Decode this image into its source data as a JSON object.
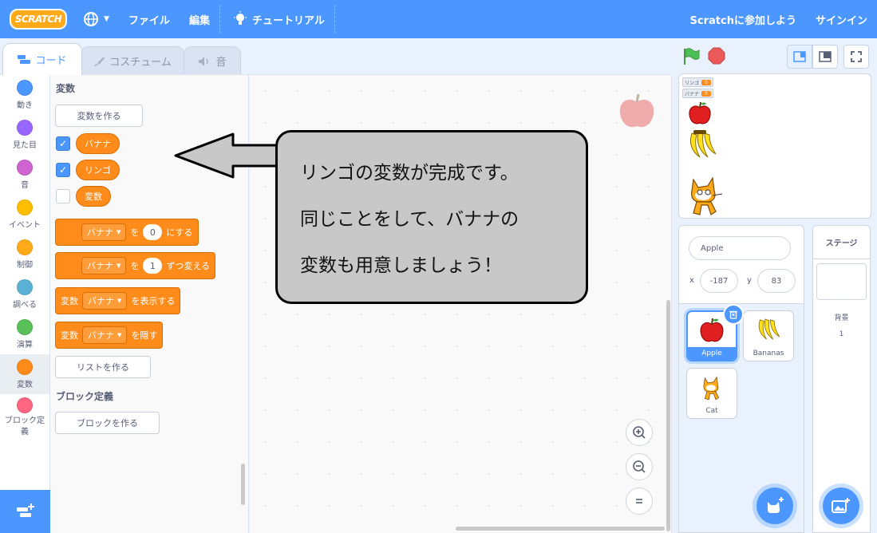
{
  "menu": {
    "logo": "SCRATCH",
    "file": "ファイル",
    "edit": "編集",
    "tutorial": "チュートリアル",
    "join": "Scratchに参加しよう",
    "signin": "サインイン"
  },
  "tabs": {
    "code": "コード",
    "costume": "コスチューム",
    "sound": "音"
  },
  "categories": [
    {
      "label": "動き",
      "color": "#4c97ff"
    },
    {
      "label": "見た目",
      "color": "#9966ff"
    },
    {
      "label": "音",
      "color": "#cf63cf"
    },
    {
      "label": "イベント",
      "color": "#ffbf00"
    },
    {
      "label": "制御",
      "color": "#ffab19"
    },
    {
      "label": "調べる",
      "color": "#5cb1d6"
    },
    {
      "label": "演算",
      "color": "#59c059"
    },
    {
      "label": "変数",
      "color": "#ff8c1a"
    },
    {
      "label": "ブロック定義",
      "color": "#ff6680"
    }
  ],
  "palette": {
    "heading": "変数",
    "make_variable": "変数を作る",
    "variables": [
      "バナナ",
      "リンゴ",
      "変数"
    ],
    "block_set": {
      "var": "バナナ",
      "to": "を",
      "value": "0",
      "suffix": "にする"
    },
    "block_change": {
      "var": "バナナ",
      "by": "を",
      "value": "1",
      "suffix": "ずつ変える"
    },
    "block_show": {
      "prefix": "変数",
      "var": "バナナ",
      "suffix": "を表示する"
    },
    "block_hide": {
      "prefix": "変数",
      "var": "バナナ",
      "suffix": "を隠す"
    },
    "make_list": "リストを作る",
    "my_blocks_heading": "ブロック定義",
    "make_block": "ブロックを作る"
  },
  "callout": {
    "line1": "リンゴの変数が完成です。",
    "line2": "同じことをして、バナナの",
    "line3": "変数も用意しましょう！"
  },
  "stage": {
    "monitors": [
      {
        "name": "リンゴ",
        "value": "0"
      },
      {
        "name": "バナナ",
        "value": "0"
      }
    ]
  },
  "sprite_info": {
    "name": "Apple",
    "x_label": "x",
    "x": "-187",
    "y_label": "y",
    "y": "83"
  },
  "sprites": [
    "Apple",
    "Bananas",
    "Cat"
  ],
  "stage_pane": {
    "title": "ステージ",
    "backdrops_label": "背景",
    "backdrops_count": "1"
  }
}
